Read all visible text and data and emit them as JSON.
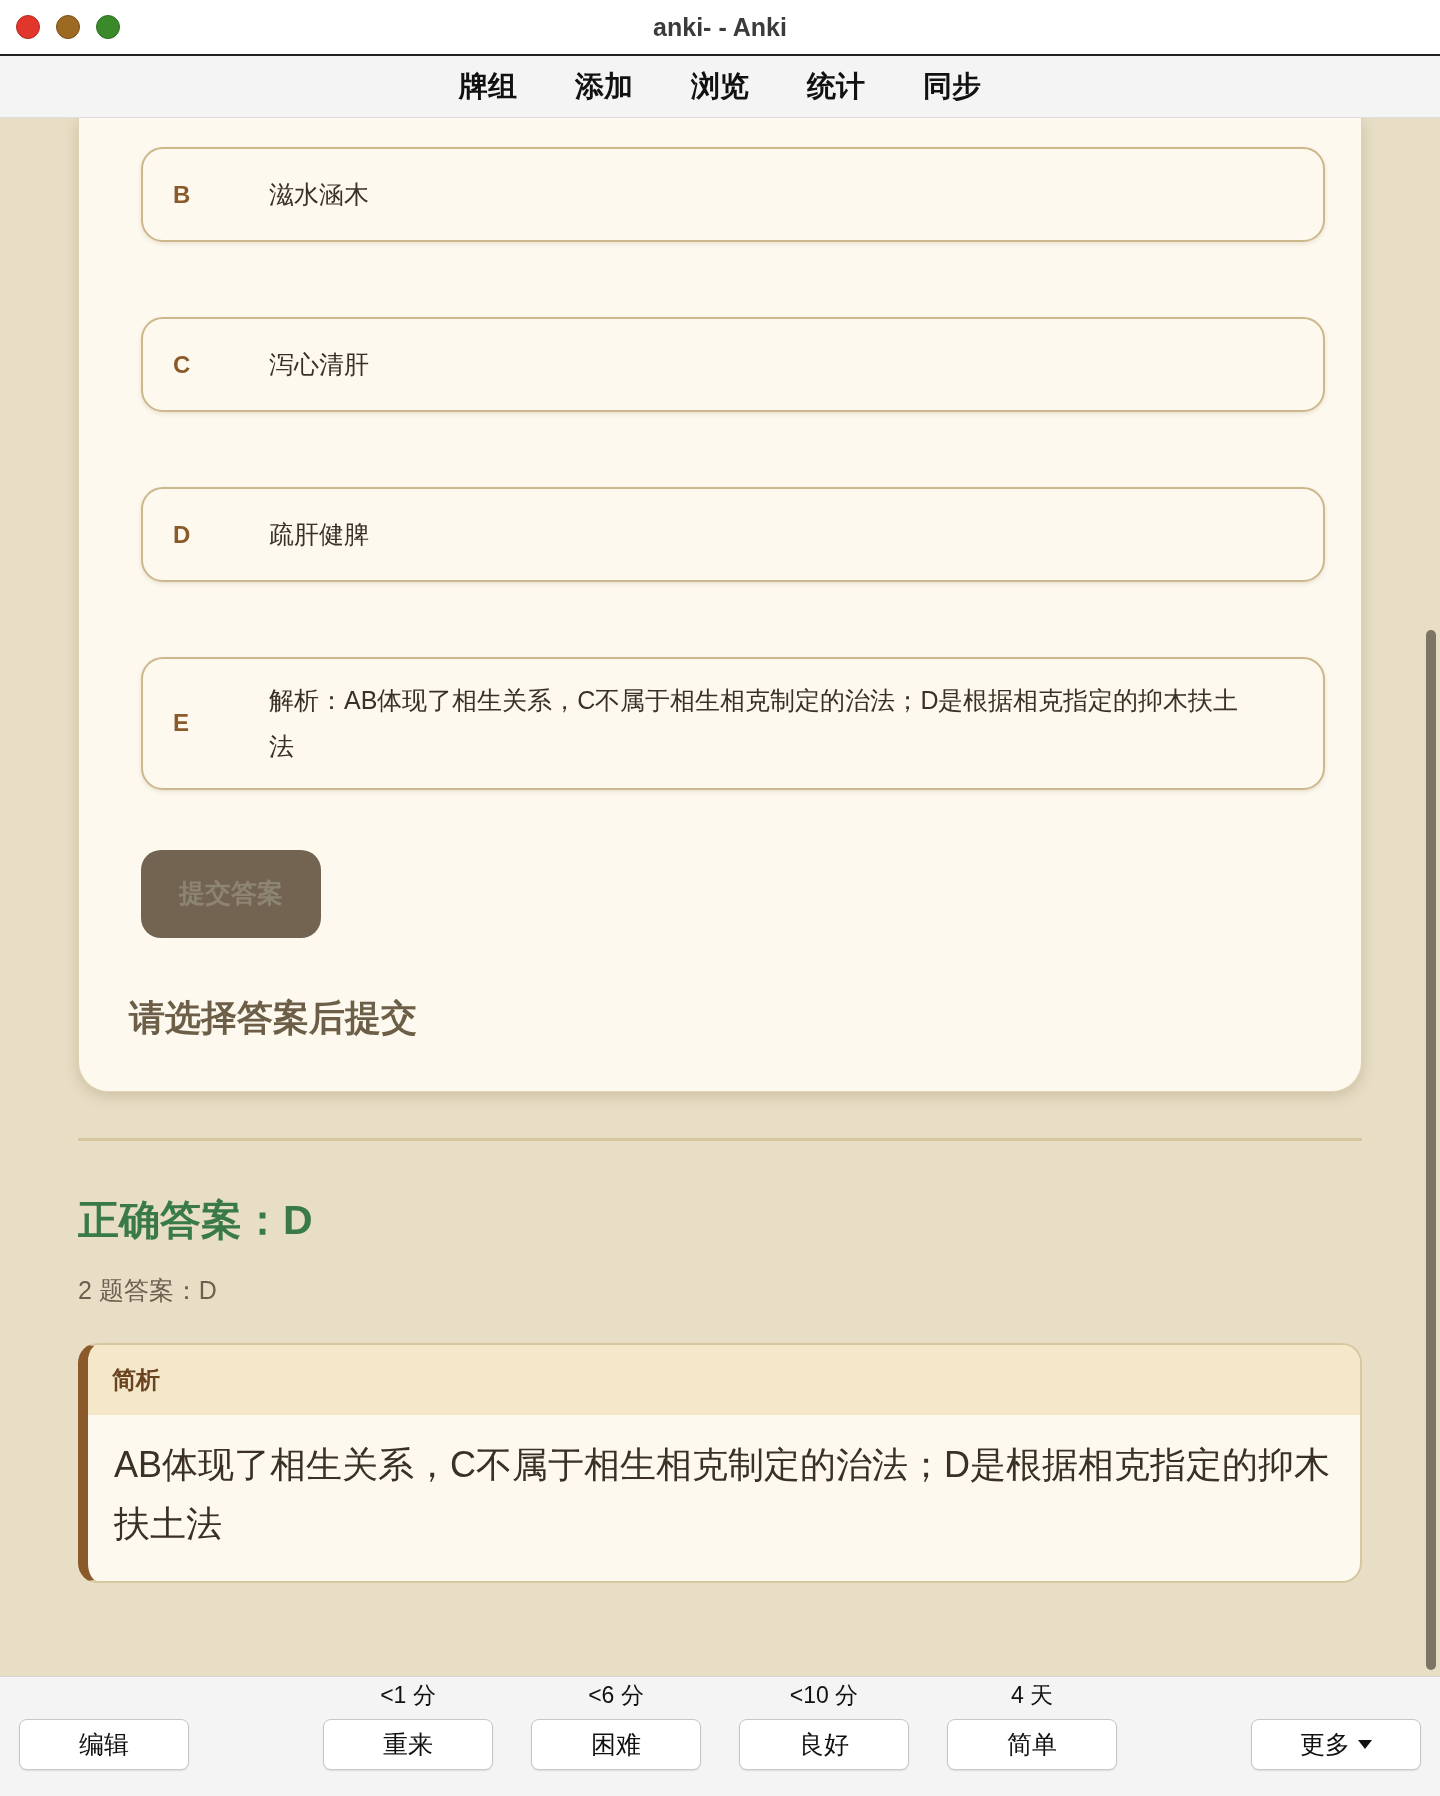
{
  "window": {
    "title": "anki- - Anki"
  },
  "toolbar": {
    "items": [
      "牌组",
      "添加",
      "浏览",
      "统计",
      "同步"
    ]
  },
  "options": [
    {
      "letter": "B",
      "text": "滋水涵木"
    },
    {
      "letter": "C",
      "text": "泻心清肝"
    },
    {
      "letter": "D",
      "text": "疏肝健脾"
    },
    {
      "letter": "E",
      "text": "解析：AB体现了相生关系，C不属于相生相克制定的治法；D是根据相克指定的抑木扶土法"
    }
  ],
  "submit_button": {
    "label": "提交答案",
    "disabled": true
  },
  "prompt": "请选择答案后提交",
  "correct_answer": "正确答案：D",
  "answer_note": "2 题答案：D",
  "explanation": {
    "title": "简析",
    "text": "AB体现了相生关系，C不属于相生相克制定的治法；D是根据相克指定的抑木扶土法"
  },
  "bottom_bar": {
    "edit": "编辑",
    "answers": [
      {
        "interval": "<1 分",
        "label": "重来"
      },
      {
        "interval": "<6 分",
        "label": "困难"
      },
      {
        "interval": "<10 分",
        "label": "良好"
      },
      {
        "interval": "4 天",
        "label": "简单"
      }
    ],
    "more": "更多"
  }
}
